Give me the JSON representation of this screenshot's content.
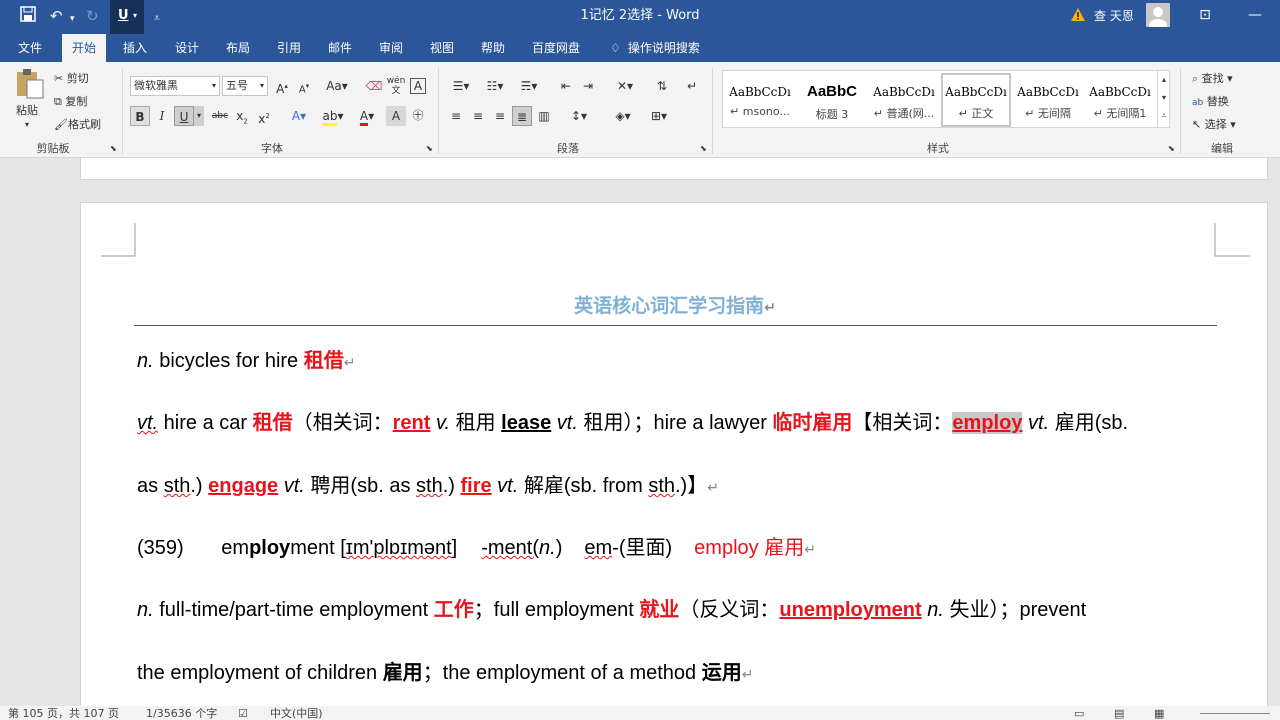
{
  "title_bar": {
    "document_title": "1记忆 2选择 - Word",
    "user_name": "查 天恩",
    "format_button": "U"
  },
  "menu_tabs": [
    "文件",
    "开始",
    "插入",
    "设计",
    "布局",
    "引用",
    "邮件",
    "审阅",
    "视图",
    "帮助",
    "百度网盘",
    "操作说明搜索"
  ],
  "active_tab": "开始",
  "ribbon": {
    "clipboard": {
      "paste": "粘贴",
      "cut": "剪切",
      "copy": "复制",
      "format_painter": "格式刷",
      "label": "剪贴板"
    },
    "font": {
      "font_name": "微软雅黑",
      "font_size": "五号",
      "label": "字体",
      "phonetic": "wén"
    },
    "paragraph": {
      "label": "段落"
    },
    "styles": {
      "label": "样式",
      "items": [
        {
          "preview": "AaBbCcDı",
          "name": "↵ msono..."
        },
        {
          "preview": "AaBbC",
          "name": "标题 3"
        },
        {
          "preview": "AaBbCcDı",
          "name": "↵ 普通(网..."
        },
        {
          "preview": "AaBbCcDı",
          "name": "↵ 正文"
        },
        {
          "preview": "AaBbCcDı",
          "name": "↵ 无间隔"
        },
        {
          "preview": "AaBbCcDı",
          "name": "↵ 无间隔1"
        }
      ]
    },
    "editing": {
      "find": "查找",
      "replace": "替换",
      "select": "选择",
      "label": "编辑"
    }
  },
  "document": {
    "heading": "英语核心词汇学习指南",
    "lines": {
      "l1": {
        "pos": "n.",
        "text": " bicycles for hire ",
        "cn": "租借"
      },
      "l2": {
        "pos": "vt.",
        "t1": " hire a car ",
        "cn1": "租借",
        "p1": "（相关词：",
        "w1": "rent",
        "pos1": "v.",
        "m1": "租用",
        "w2": "lease",
        "pos2": "vt.",
        "m2": "租用）；hire a lawyer ",
        "cn2": "临时雇用",
        "p2": "【相关词：",
        "w3": "employ",
        "pos3": "vt.",
        "m3": "雇用(sb."
      },
      "l3": {
        "t1": "as ",
        "w_sth1": "sth",
        "t2": ".) ",
        "w1": "engage",
        "pos1": "vt.",
        "m1": " 聘用(sb. as ",
        "w_sth2": "sth",
        "t3": ".) ",
        "w2": "fire",
        "pos2": "vt.",
        "m2": " 解雇(sb. from ",
        "w_sth3": "sth",
        "t4": ".)】"
      },
      "l4": {
        "num": "(359)",
        "w_em": "em",
        "w_ploy": "ploy",
        "w_ment": "ment",
        "ipa_a": "[",
        "ipa_b": "ɪm'plɒɪmənt",
        "ipa_c": "]",
        "suffix": "-ment(",
        "suffix_pos": "n.",
        "suffix_c": ")",
        "prefix": "em",
        "prefix_m": "-(里面)",
        "root": "employ",
        "root_m": "雇用"
      },
      "l5": {
        "pos": "n.",
        "t1": " full-time/part-time employment ",
        "cn1": "工作",
        "t2": "；full employment ",
        "cn2": "就业",
        "p1": "（反义词：",
        "w1": "unemployment",
        "pos1": "n.",
        "m1": " 失业）；prevent"
      },
      "l6": {
        "t1": "the employment of children ",
        "cn1": "雇用",
        "t2": "；the employment of a method ",
        "cn2": "运用"
      }
    }
  },
  "status_bar": {
    "page": "第 105 页，共 107 页",
    "words": "1/35636 个字",
    "lang": "中文(中国)"
  }
}
